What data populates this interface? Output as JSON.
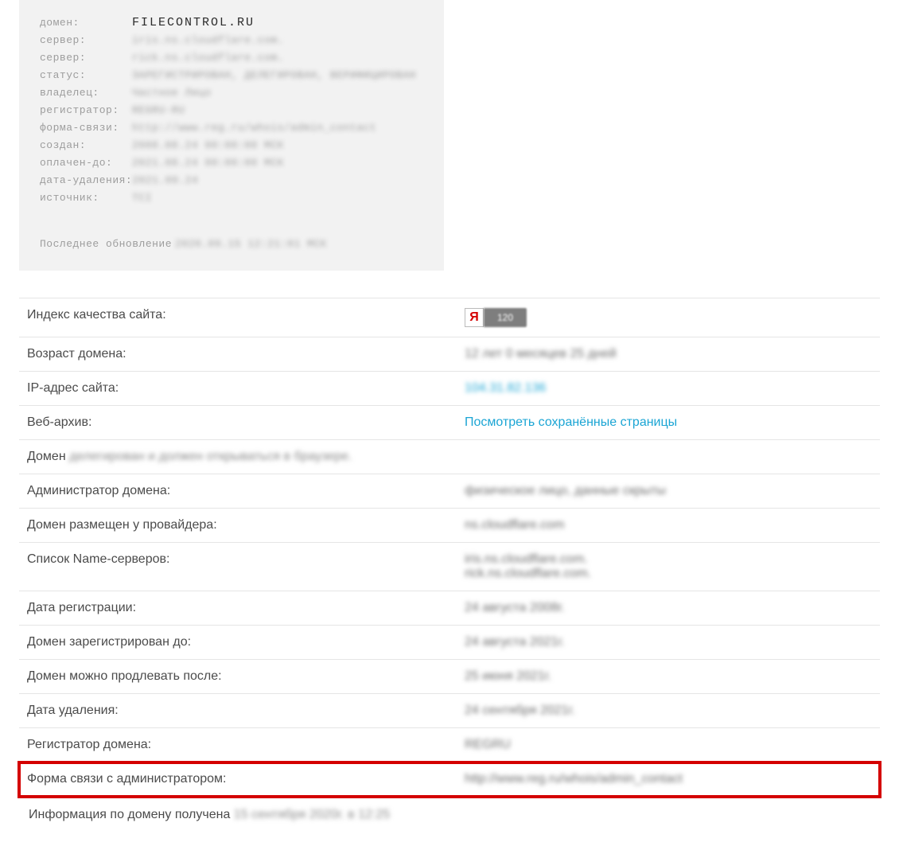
{
  "whois": {
    "rows": [
      {
        "label": "домен:",
        "value": "FILECONTROL.RU"
      },
      {
        "label": "сервер:",
        "value": "iris.ns.cloudflare.com."
      },
      {
        "label": "сервер:",
        "value": "rick.ns.cloudflare.com."
      },
      {
        "label": "статус:",
        "value": "ЗАРЕГИСТРИРОВАН, ДЕЛЕГИРОВАН, ВЕРИФИЦИРОВАН"
      },
      {
        "label": "владелец:",
        "value": "Частное Лицо"
      },
      {
        "label": "регистратор:",
        "value": "REGRU-RU"
      },
      {
        "label": "форма-связи:",
        "value": "http://www.reg.ru/whois/admin_contact"
      },
      {
        "label": "создан:",
        "value": "2008.08.24 00:00:00 МСК"
      },
      {
        "label": "оплачен-до:",
        "value": "2021.08.24 00:00:00 МСК"
      },
      {
        "label": "дата-удаления:",
        "value": "2021.09.24"
      },
      {
        "label": "источник:",
        "value": "TCI"
      }
    ],
    "footer_label": "Последнее обновление",
    "footer_value": "2020.09.15 12:21:01 МСК"
  },
  "info": {
    "iq_label": "Индекс качества сайта:",
    "iq_badge_letter": "Я",
    "iq_badge_value": "120",
    "age_label": "Возраст домена:",
    "age_value": "12 лет 0 месяцев 25 дней",
    "ip_label": "IP-адрес сайта:",
    "ip_value": "104.31.82.136",
    "archive_label": "Веб-архив:",
    "archive_link": "Посмотреть сохранённые страницы",
    "delegated_prefix": "Домен ",
    "delegated_rest": "делегирован и должен открываться в браузере.",
    "admin_label": "Администратор домена:",
    "admin_value": "физическое лицо, данные скрыты",
    "provider_label": "Домен размещен у провайдера:",
    "provider_value": "ns.cloudflare.com",
    "ns_label": "Список Name-серверов:",
    "ns_value1": "iris.ns.cloudflare.com.",
    "ns_value2": "rick.ns.cloudflare.com.",
    "regdate_label": "Дата регистрации:",
    "regdate_value": "24 августа 2008г.",
    "until_label": "Домен зарегистрирован до:",
    "until_value": "24 августа 2021г.",
    "renew_label": "Домен можно продлевать после:",
    "renew_value": "25 июня 2021г.",
    "delete_label": "Дата удаления:",
    "delete_value": "24 сентября 2021г.",
    "registrar_label": "Регистратор домена:",
    "registrar_value": "REGRU",
    "contact_label": "Форма связи с администратором:",
    "contact_value": "http://www.reg.ru/whois/admin_contact",
    "footer_prefix": "Информация по домену получена ",
    "footer_rest": "15 сентября 2020г. в 12:25"
  }
}
